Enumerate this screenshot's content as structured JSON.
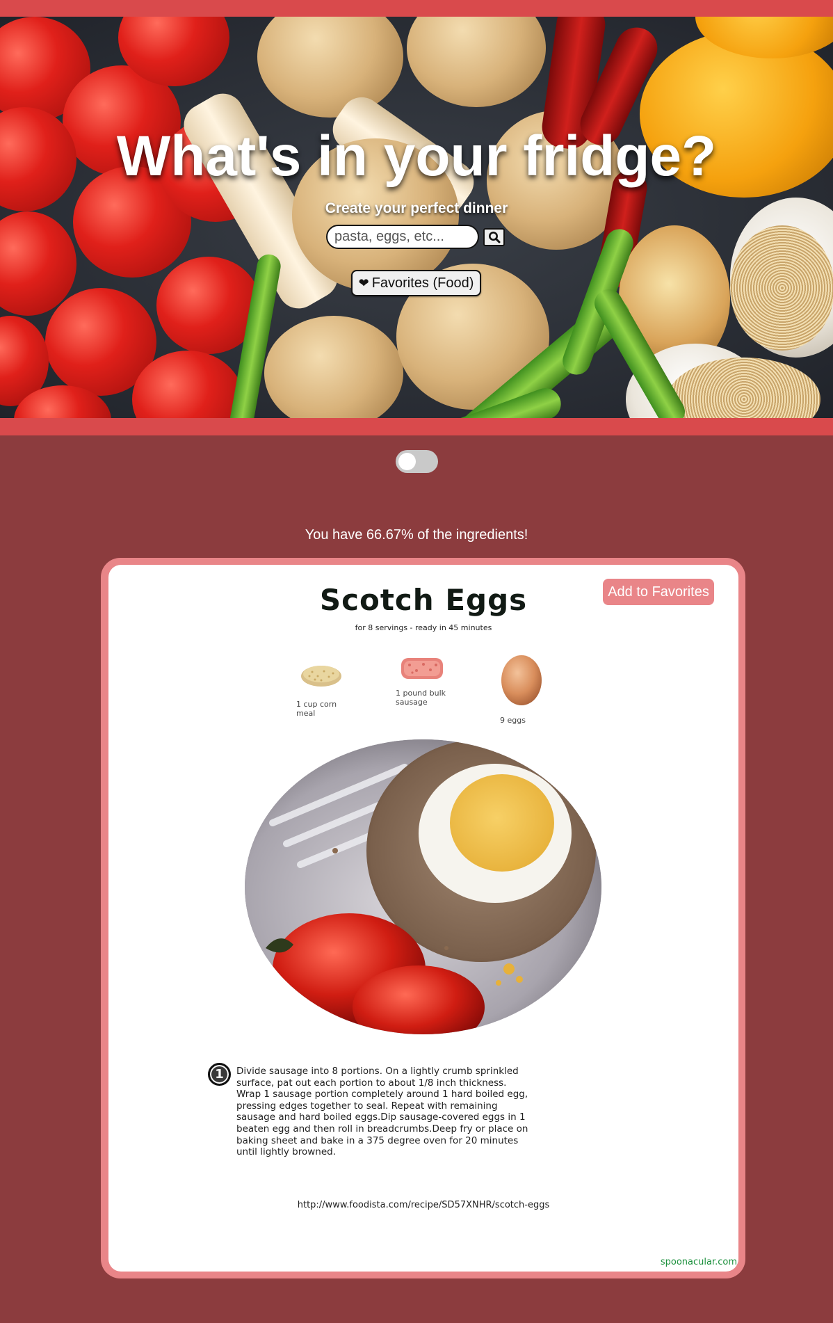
{
  "hero": {
    "title": "What's in your fridge?",
    "subtitle": "Create your perfect dinner",
    "search_placeholder": "pasta, eggs, etc...",
    "search_button_icon": "search-icon",
    "favorites_button_icon": "heart-icon",
    "favorites_button_label": "Favorites (Food)"
  },
  "toggle": {
    "state": "off"
  },
  "match_text": "You have 66.67% of the ingredients!",
  "recipe": {
    "add_favorites_label": "Add to Favorites",
    "title": "Scotch Eggs",
    "meta": "for 8 servings - ready in 45 minutes",
    "ingredients": [
      {
        "label": "1 cup corn meal",
        "icon": "corn-meal-icon"
      },
      {
        "label": "1 pound bulk sausage",
        "icon": "sausage-icon"
      },
      {
        "label": "9  eggs",
        "icon": "egg-icon"
      }
    ],
    "steps": [
      {
        "number": "1",
        "text": "Divide sausage into 8 portions. On a lightly crumb sprinkled surface, pat out each portion to about 1/8 inch thickness. Wrap 1 sausage portion completely around 1 hard boiled egg, pressing edges together to seal. Repeat with remaining sausage and hard boiled eggs.Dip sausage-covered eggs in 1 beaten egg and then roll in breadcrumbs.Deep fry or place on baking sheet and bake in a 375 degree oven for 20 minutes until lightly browned."
      }
    ],
    "source_url": "http://www.foodista.com/recipe/SD57XNHR/scotch-eggs",
    "credit": "spoonacular.com"
  },
  "colors": {
    "page_background": "#8c3c3e",
    "hero_frame": "#d94a4c",
    "card_border": "#e98588",
    "accent_button": "#e98588",
    "credit_text": "#1a8f3b"
  }
}
